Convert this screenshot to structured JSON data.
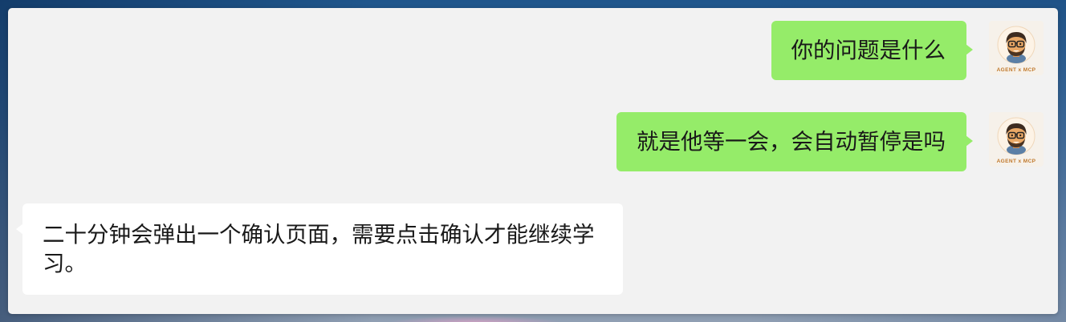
{
  "colors": {
    "outgoing_bubble": "#95ec69",
    "incoming_bubble": "#ffffff",
    "text": "#191919",
    "window_background": "#f2f2f2"
  },
  "messages": [
    {
      "direction": "outgoing",
      "text": "你的问题是什么",
      "avatar": {
        "icon": "agent-avatar-icon",
        "caption": "AGENT x MCP"
      }
    },
    {
      "direction": "outgoing",
      "text": "就是他等一会，会自动暂停是吗",
      "avatar": {
        "icon": "agent-avatar-icon",
        "caption": "AGENT x MCP"
      }
    },
    {
      "direction": "incoming",
      "text": "二十分钟会弹出一个确认页面，需要点击确认才能继续学习。"
    }
  ]
}
